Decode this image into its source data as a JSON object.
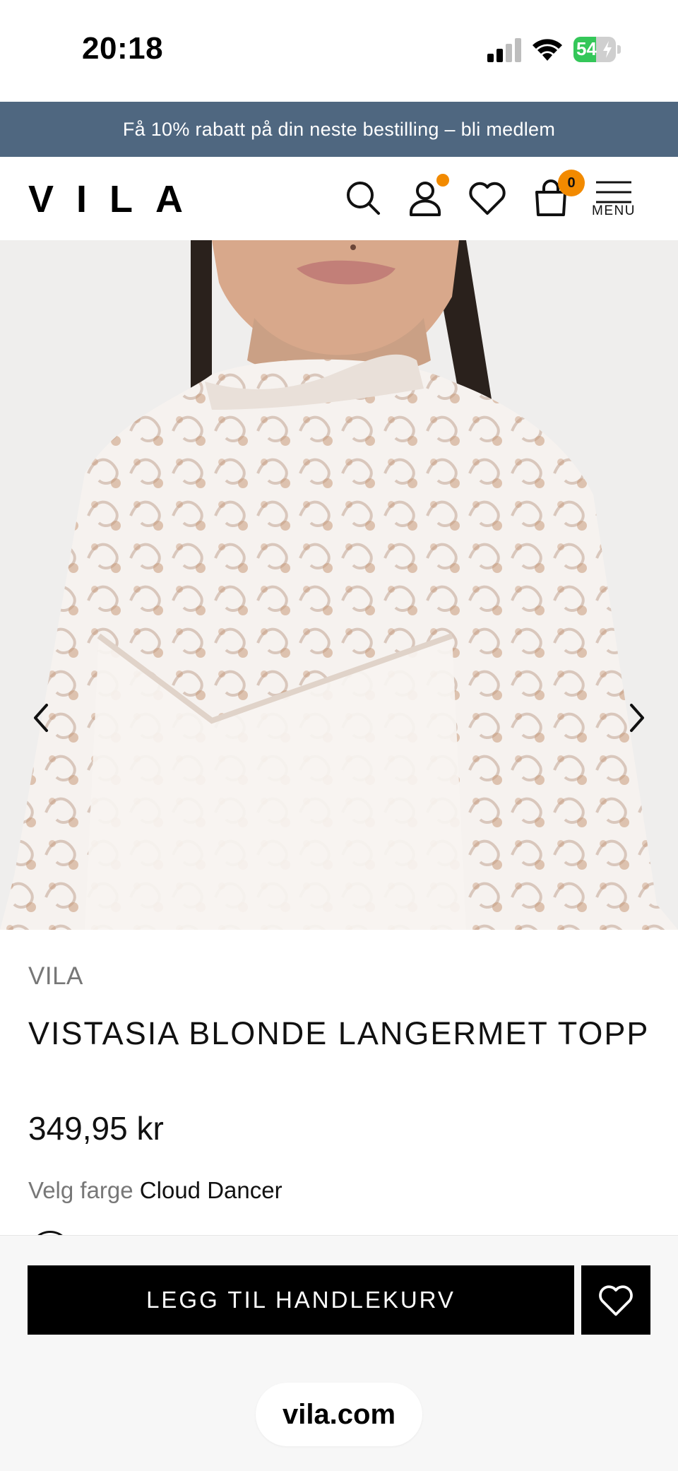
{
  "status_bar": {
    "time": "20:18",
    "battery_percent": "54",
    "battery_level": 0.54,
    "icons": [
      "cellular-signal-icon",
      "wifi-icon",
      "battery-charging-icon"
    ]
  },
  "promo_banner": {
    "text": "Få 10% rabatt på din neste bestilling – bli medlem"
  },
  "header": {
    "logo_text": "VILA",
    "icons": [
      "search-icon",
      "account-icon",
      "wishlist-icon",
      "cart-icon",
      "menu-icon"
    ],
    "cart_count": "0",
    "menu_label": "MENU",
    "accent_color": "#f28a00"
  },
  "gallery": {
    "image_alt": "Model wearing white lace long-sleeve top",
    "prev_icon": "chevron-left-icon",
    "next_icon": "chevron-right-icon"
  },
  "product": {
    "brand": "VILA",
    "name": "VISTASIA BLONDE LANGERMET TOPP",
    "price": "349,95 kr",
    "color_label": "Velg farge",
    "color_value": "Cloud Dancer"
  },
  "actions": {
    "add_to_cart_label": "LEGG TIL HANDLEKURV",
    "wishlist_icon": "heart-icon"
  },
  "browser": {
    "url": "vila.com"
  },
  "colors": {
    "banner_bg": "#4f6780",
    "button_bg": "#000000",
    "badge": "#f28a00",
    "battery_green": "#34c759"
  }
}
